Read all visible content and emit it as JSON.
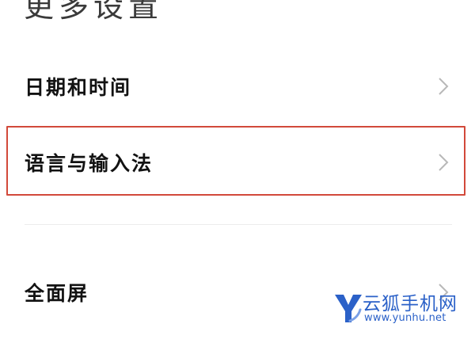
{
  "page": {
    "title": "更多设置"
  },
  "settings": {
    "items": [
      {
        "label": "日期和时间",
        "chevron_icon": "chevron-right-icon"
      },
      {
        "label": "语言与输入法",
        "chevron_icon": "chevron-right-icon",
        "highlighted": true
      },
      {
        "label": "全面屏",
        "chevron_icon": "chevron-right-icon"
      }
    ]
  },
  "watermark": {
    "brand": "云狐手机网",
    "url": "www.yunhu.net",
    "logo_icon": "yunhu-logo-icon",
    "color": "#2b61c8"
  },
  "colors": {
    "highlight_border": "#d2493a",
    "text_primary": "#121212",
    "chevron": "#b8b8b8"
  }
}
